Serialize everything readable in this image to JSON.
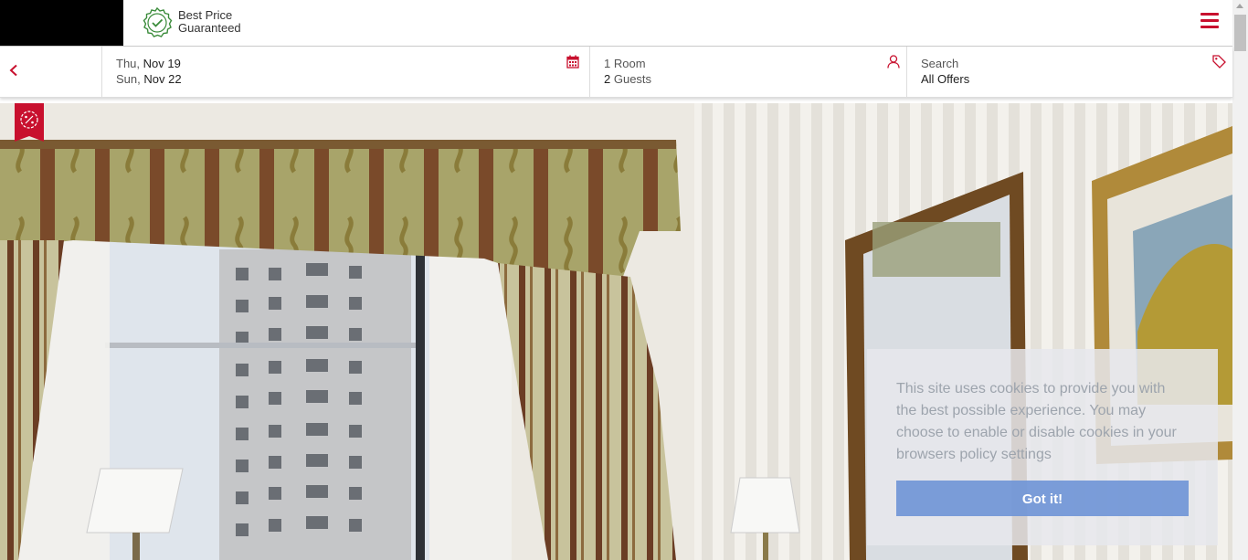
{
  "header": {
    "badge_line1": "Best Price",
    "badge_line2": "Guaranteed",
    "menu_icon": "hamburger-icon"
  },
  "search": {
    "checkin_day": "Thu,",
    "checkin_date": "Nov 19",
    "checkout_day": "Sun,",
    "checkout_date": "Nov 22",
    "rooms_count": "1",
    "rooms_label": "Room",
    "guests_count": "2",
    "guests_label": "Guests",
    "offers_label": "Search",
    "offers_value": "All Offers",
    "back_icon": "chevron-left-icon",
    "calendar_icon": "calendar-icon",
    "user_icon": "user-icon",
    "tag_icon": "tag-icon"
  },
  "cookie": {
    "message": "This site uses cookies to provide you with the best possible experience. You may choose to enable or disable cookies in your browsers policy settings",
    "button": "Got it!"
  },
  "colors": {
    "accent": "#c8102e",
    "cookie_button": "#6e93d6"
  }
}
